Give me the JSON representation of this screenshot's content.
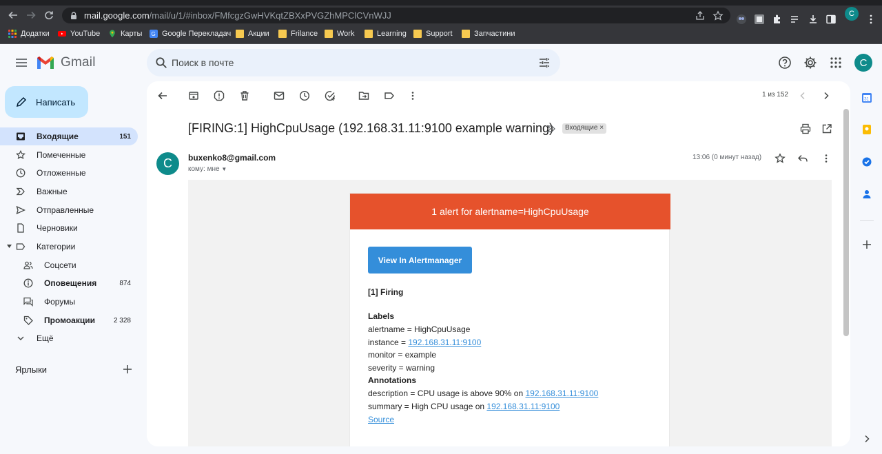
{
  "browser": {
    "url_host": "mail.google.com",
    "url_path": "/mail/u/1/#inbox/FMfcgzGwHVKqtZBXxPVGZhMPClCVnWJJ",
    "profile_initial": "C",
    "bookmarks": [
      {
        "label": "Додатки",
        "icon": "apps-grid-icon"
      },
      {
        "label": "YouTube",
        "icon": "youtube-icon"
      },
      {
        "label": "Карты",
        "icon": "maps-pin-icon"
      },
      {
        "label": "Google Перекладач",
        "icon": "translate-icon"
      },
      {
        "label": "Акции",
        "icon": "folder-icon"
      },
      {
        "label": "Frilance",
        "icon": "folder-icon"
      },
      {
        "label": "Work",
        "icon": "folder-icon"
      },
      {
        "label": "Learning",
        "icon": "folder-icon"
      },
      {
        "label": "Support",
        "icon": "folder-icon"
      },
      {
        "label": "Запчастини",
        "icon": "folder-icon"
      }
    ]
  },
  "gmail": {
    "logo_text": "Gmail",
    "search_placeholder": "Поиск в почте",
    "account_initial": "C",
    "compose_label": "Написать",
    "nav": [
      {
        "label": "Входящие",
        "count": "151",
        "icon": "inbox-icon"
      },
      {
        "label": "Помеченные",
        "count": "",
        "icon": "star-icon"
      },
      {
        "label": "Отложенные",
        "count": "",
        "icon": "clock-icon"
      },
      {
        "label": "Важные",
        "count": "",
        "icon": "important-icon"
      },
      {
        "label": "Отправленные",
        "count": "",
        "icon": "send-icon"
      },
      {
        "label": "Черновики",
        "count": "",
        "icon": "draft-icon"
      },
      {
        "label": "Категории",
        "count": "",
        "icon": "label-icon"
      },
      {
        "label": "Соцсети",
        "count": "",
        "icon": "people-icon"
      },
      {
        "label": "Оповещения",
        "count": "874",
        "icon": "info-icon"
      },
      {
        "label": "Форумы",
        "count": "",
        "icon": "forum-icon"
      },
      {
        "label": "Промоакции",
        "count": "2 328",
        "icon": "tag-icon"
      },
      {
        "label": "Ещё",
        "count": "",
        "icon": "chevron-down-icon"
      }
    ],
    "labels_title": "Ярлыки"
  },
  "message": {
    "pager": "1 из 152",
    "subject": "[FIRING:1] HighCpuUsage (192.168.31.11:9100 example warning)",
    "folder_chip": "Входящие ×",
    "sender_initial": "C",
    "sender": "buxenko8@gmail.com",
    "to": "кому: мне",
    "time": "13:06 (0 минут назад)"
  },
  "alert": {
    "header": "1 alert for alertname=HighCpuUsage",
    "button": "View In Alertmanager",
    "firing": "[1] Firing",
    "labels_heading": "Labels",
    "alertname": "alertname = HighCpuUsage",
    "instance_prefix": "instance = ",
    "instance_link": "192.168.31.11:9100",
    "monitor": "monitor = example",
    "severity": "severity = warning",
    "annotations_heading": "Annotations",
    "description_prefix": "description = CPU usage is above 90% on ",
    "description_link": "192.168.31.11:9100",
    "summary_prefix": "summary = High CPU usage on ",
    "summary_link": "192.168.31.11:9100",
    "source": "Source"
  },
  "colors": {
    "alert_header": "#e6522c",
    "alert_button": "#348eda",
    "avatar": "#0e8b8b",
    "inbox_active": "#d3e3fd",
    "compose": "#c2e7ff"
  }
}
